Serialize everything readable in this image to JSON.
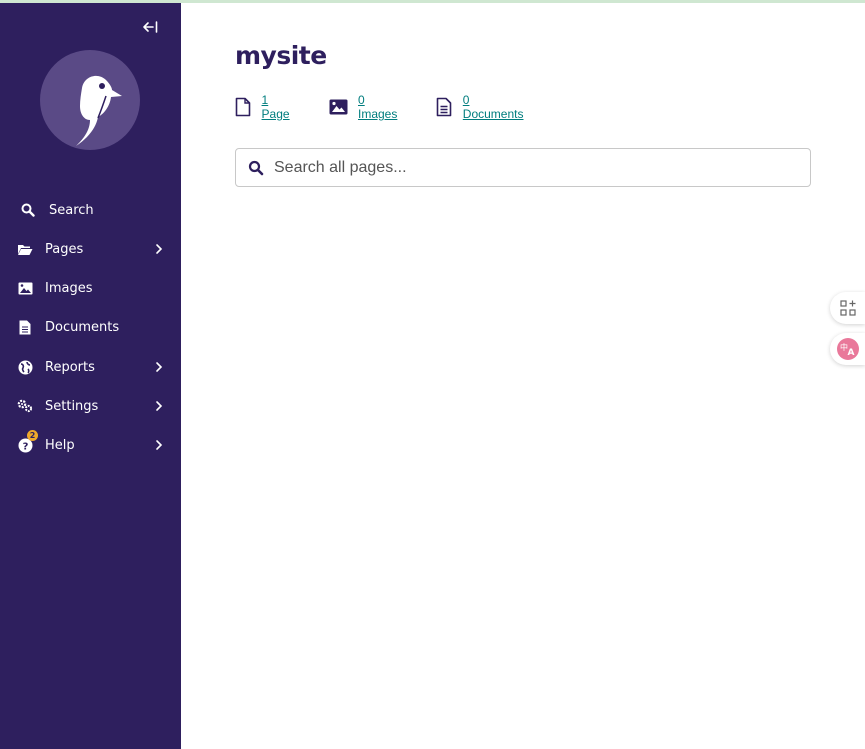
{
  "sidebar": {
    "collapse_label": "←I",
    "nav": [
      {
        "label": "Search",
        "icon": "search-icon"
      },
      {
        "label": "Pages",
        "icon": "folder-open-icon",
        "has_submenu": true
      },
      {
        "label": "Images",
        "icon": "image-icon"
      },
      {
        "label": "Documents",
        "icon": "document-icon"
      },
      {
        "label": "Reports",
        "icon": "globe-icon",
        "has_submenu": true
      },
      {
        "label": "Settings",
        "icon": "cogs-icon",
        "has_submenu": true
      },
      {
        "label": "Help",
        "icon": "help-icon",
        "has_submenu": true,
        "badge": "2"
      }
    ]
  },
  "main": {
    "site_title": "mysite",
    "stats": [
      {
        "label": "1 Page",
        "icon": "page-icon"
      },
      {
        "label": "0 Images",
        "icon": "image-icon"
      },
      {
        "label": "0 Documents",
        "icon": "document-icon"
      }
    ],
    "search": {
      "placeholder": "Search all pages..."
    }
  },
  "floating_tools": [
    {
      "icon": "apps-add-icon"
    },
    {
      "icon": "translate-icon"
    }
  ],
  "colors": {
    "sidebar_bg": "#2e1f5e",
    "link": "#007d7e",
    "badge": "#f0a92b",
    "translate_accent": "#e9789a"
  }
}
